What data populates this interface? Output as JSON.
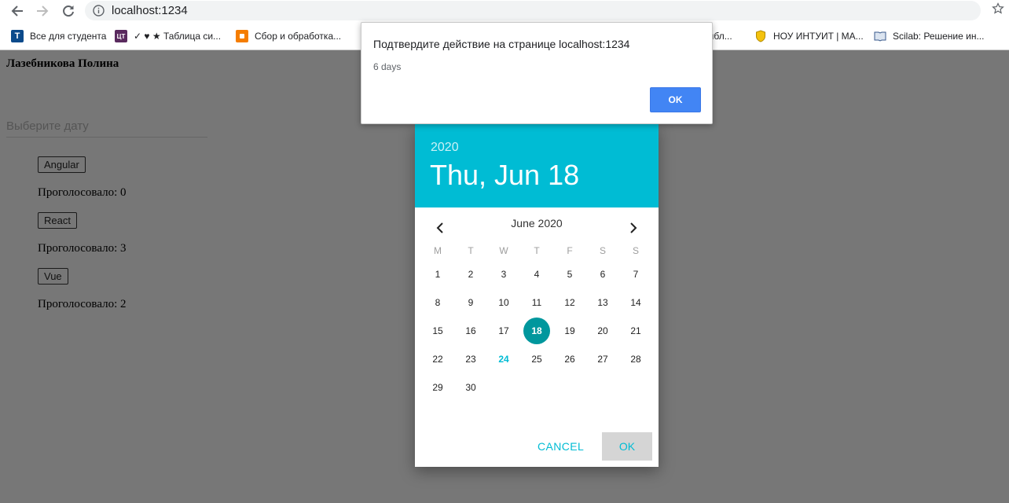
{
  "browser": {
    "url": "localhost:1234",
    "bookmarks": [
      {
        "label": "Все для студента"
      },
      {
        "label": "✓ ♥ ★ Таблица си..."
      },
      {
        "label": "Сбор и обработка..."
      },
      {
        "label": "рибл..."
      },
      {
        "label": "НОУ ИНТУИТ | МА..."
      },
      {
        "label": "Scilab: Решение ин..."
      }
    ],
    "favicons": {
      "bm0": "T",
      "bm1": "ЦТ"
    }
  },
  "page": {
    "author": "Лазебникова Полина",
    "date_placeholder": "Выберите дату",
    "votes": [
      {
        "button": "Angular",
        "count_text": "Проголосовало: 0"
      },
      {
        "button": "React",
        "count_text": "Проголосовало: 3"
      },
      {
        "button": "Vue",
        "count_text": "Проголосовало: 2"
      }
    ]
  },
  "datepicker": {
    "year": "2020",
    "selected_date": "Thu, Jun 18",
    "month_label": "June 2020",
    "weekdays": [
      "M",
      "T",
      "W",
      "T",
      "F",
      "S",
      "S"
    ],
    "days": [
      "1",
      "2",
      "3",
      "4",
      "5",
      "6",
      "7",
      "8",
      "9",
      "10",
      "11",
      "12",
      "13",
      "14",
      "15",
      "16",
      "17",
      "18",
      "19",
      "20",
      "21",
      "22",
      "23",
      "24",
      "25",
      "26",
      "27",
      "28",
      "29",
      "30"
    ],
    "first_weekday_index": 0,
    "selected_day": 18,
    "today_day": 24,
    "cancel_label": "CANCEL",
    "ok_label": "OK",
    "header_color": "#00bcd4",
    "selected_color": "#00979d"
  },
  "confirm_dialog": {
    "title": "Подтвердите действие на странице localhost:1234",
    "message": "6 days",
    "ok_label": "OK"
  }
}
